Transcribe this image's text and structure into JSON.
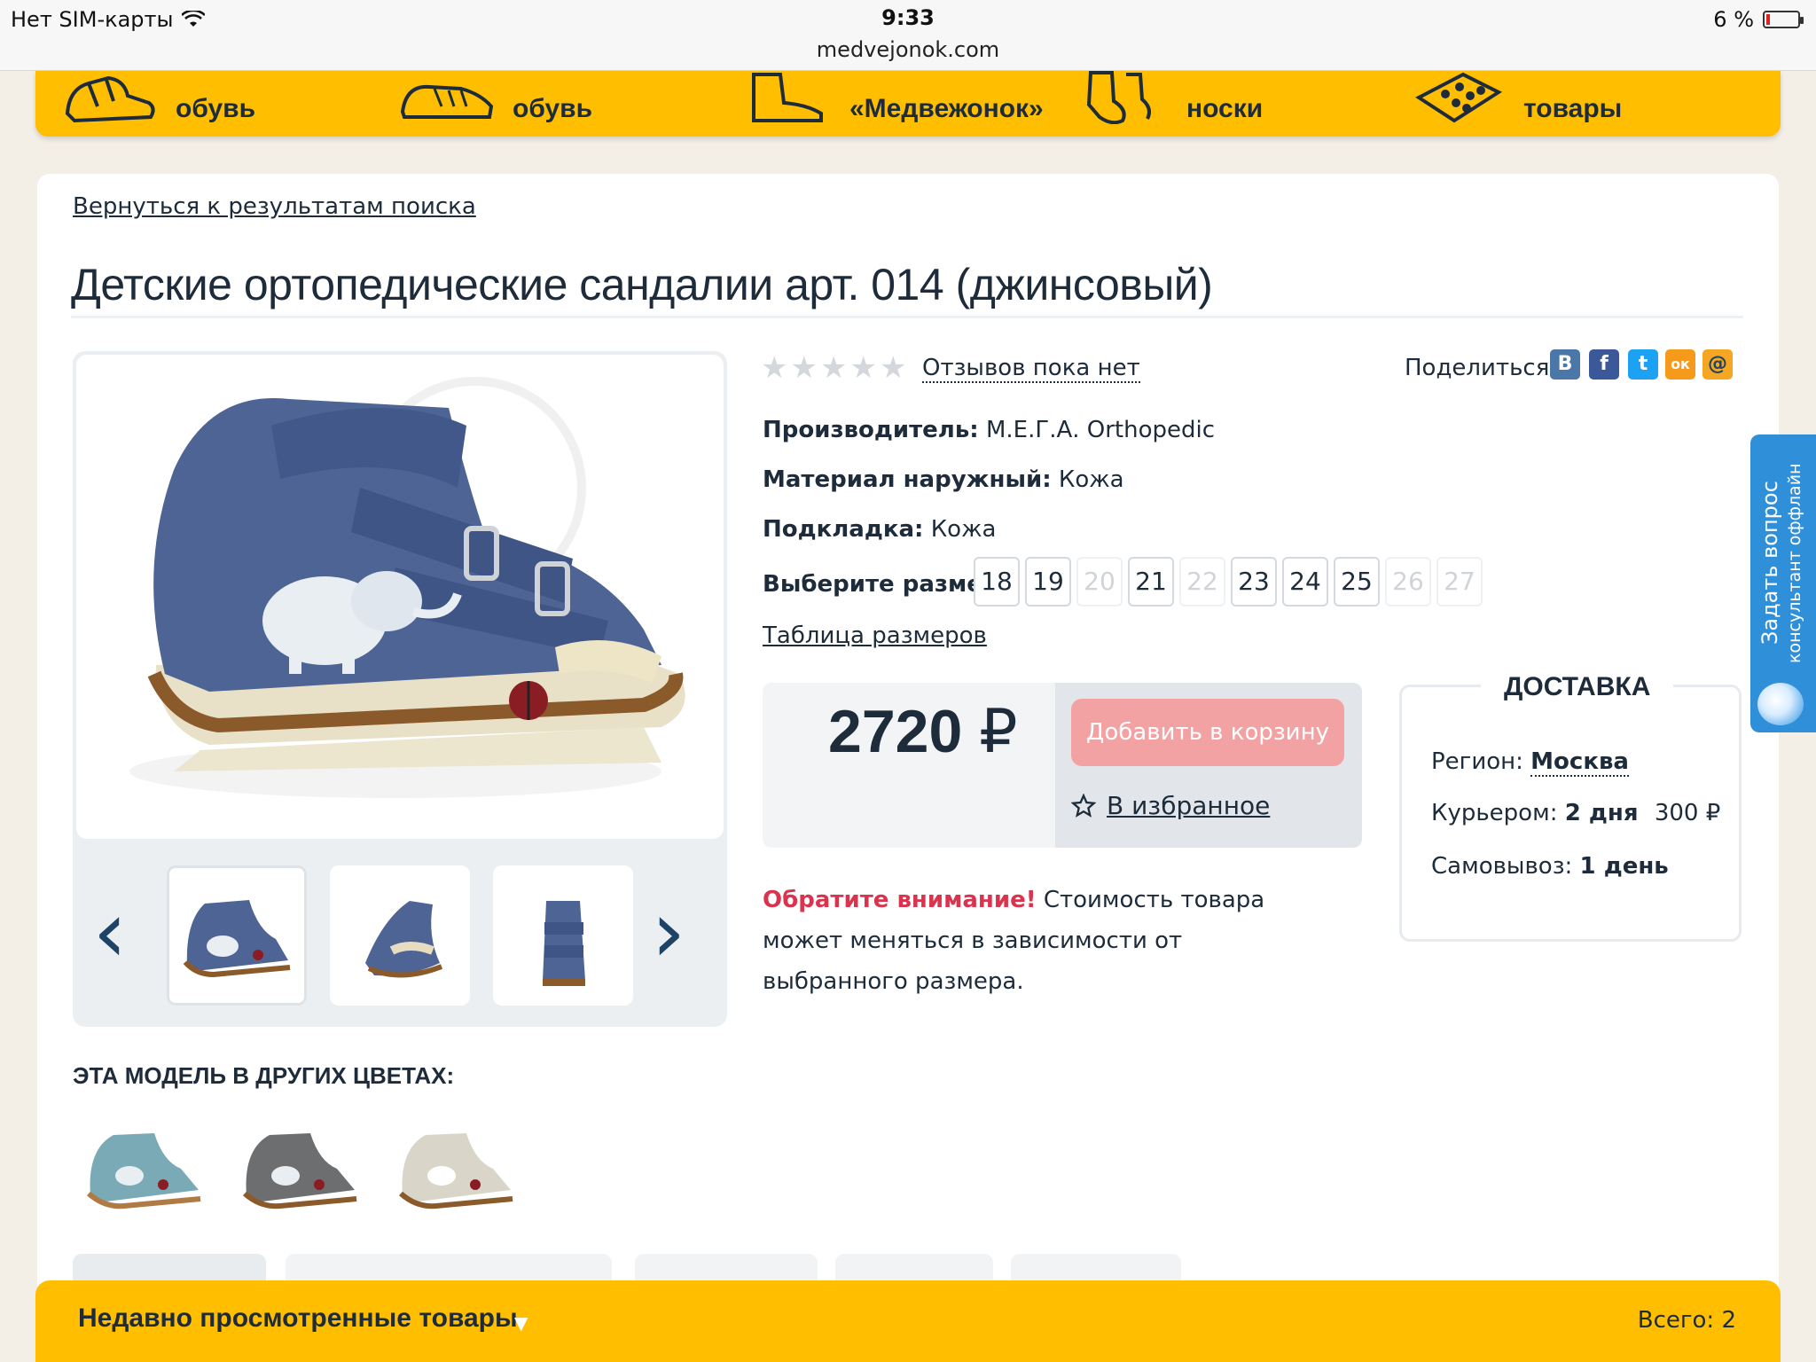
{
  "status_bar": {
    "carrier": "Нет SIM-карты",
    "time": "9:33",
    "url": "medvejonok.com",
    "battery": "6 %",
    "battery_level": 0.06
  },
  "categories": [
    {
      "label": "обувь",
      "icon": "sandal-icon"
    },
    {
      "label": "обувь",
      "icon": "sneaker-icon"
    },
    {
      "label": "«Медвежонок»",
      "icon": "boot-icon"
    },
    {
      "label": "носки",
      "icon": "socks-icon"
    },
    {
      "label": "товары",
      "icon": "massage-mat-icon"
    }
  ],
  "back_link": "Вернуться к результатам поиска",
  "product": {
    "title": "Детские ортопедические сандалии арт. 014 (джинсовый)",
    "rating": 0,
    "reviews": "Отзывов пока нет",
    "share_label": "Поделиться",
    "share_icons": [
      {
        "name": "vk-icon",
        "glyph": "В",
        "color": "#4a76a8"
      },
      {
        "name": "facebook-icon",
        "glyph": "f",
        "color": "#3b5998"
      },
      {
        "name": "twitter-icon",
        "glyph": "t",
        "color": "#1da1f2"
      },
      {
        "name": "odnoklassniki-icon",
        "glyph": "ок",
        "color": "#f59a1a"
      },
      {
        "name": "mailru-icon",
        "glyph": "@",
        "color": "#f5a623"
      }
    ],
    "manufacturer_label": "Производитель:",
    "manufacturer": "М.Е.Г.А. Orthopedic",
    "outer_material_label": "Материал наружный:",
    "outer_material": "Кожа",
    "lining_label": "Подкладка:",
    "lining": "Кожа",
    "size_label": "Выберите размер:",
    "sizes": [
      {
        "value": "18",
        "available": true
      },
      {
        "value": "19",
        "available": true
      },
      {
        "value": "20",
        "available": false
      },
      {
        "value": "21",
        "available": true
      },
      {
        "value": "22",
        "available": false
      },
      {
        "value": "23",
        "available": true
      },
      {
        "value": "24",
        "available": true
      },
      {
        "value": "25",
        "available": true
      },
      {
        "value": "26",
        "available": false
      },
      {
        "value": "27",
        "available": false
      }
    ],
    "size_table": "Таблица размеров",
    "price": "2720",
    "currency": "₽",
    "add_to_cart": "Добавить в корзину",
    "favorite": "В избранное",
    "note_bold": "Обратите внимание!",
    "note_text": " Стоимость товара может меняться в зависимости от выбранного размера."
  },
  "delivery": {
    "title": "ДОСТАВКА",
    "region_label": "Регион:",
    "region": "Москва",
    "courier_label": "Курьером:",
    "courier_days": "2 дня",
    "courier_price": "300 ₽",
    "pickup_label": "Самовывоз:",
    "pickup_days": "1 день"
  },
  "other_colors": {
    "heading": "ЭТА МОДЕЛЬ В ДРУГИХ ЦВЕТАХ:",
    "items": [
      {
        "color": "#7aaab6"
      },
      {
        "color": "#6c6e70"
      },
      {
        "color": "#d9d5c8"
      }
    ]
  },
  "sidetab": {
    "title": "Задать вопрос",
    "subtitle": "консультант оффлайн"
  },
  "recent": {
    "label": "Недавно просмотренные товары",
    "total": "Всего: 2"
  },
  "colors": {
    "accent_yellow": "#ffbf00",
    "text_navy": "#1d2b3a",
    "cart_pink": "#f3a2a4",
    "alert_red": "#d9334e",
    "side_blue": "#2f8fd8",
    "shoe_denim": "#4d6494"
  }
}
